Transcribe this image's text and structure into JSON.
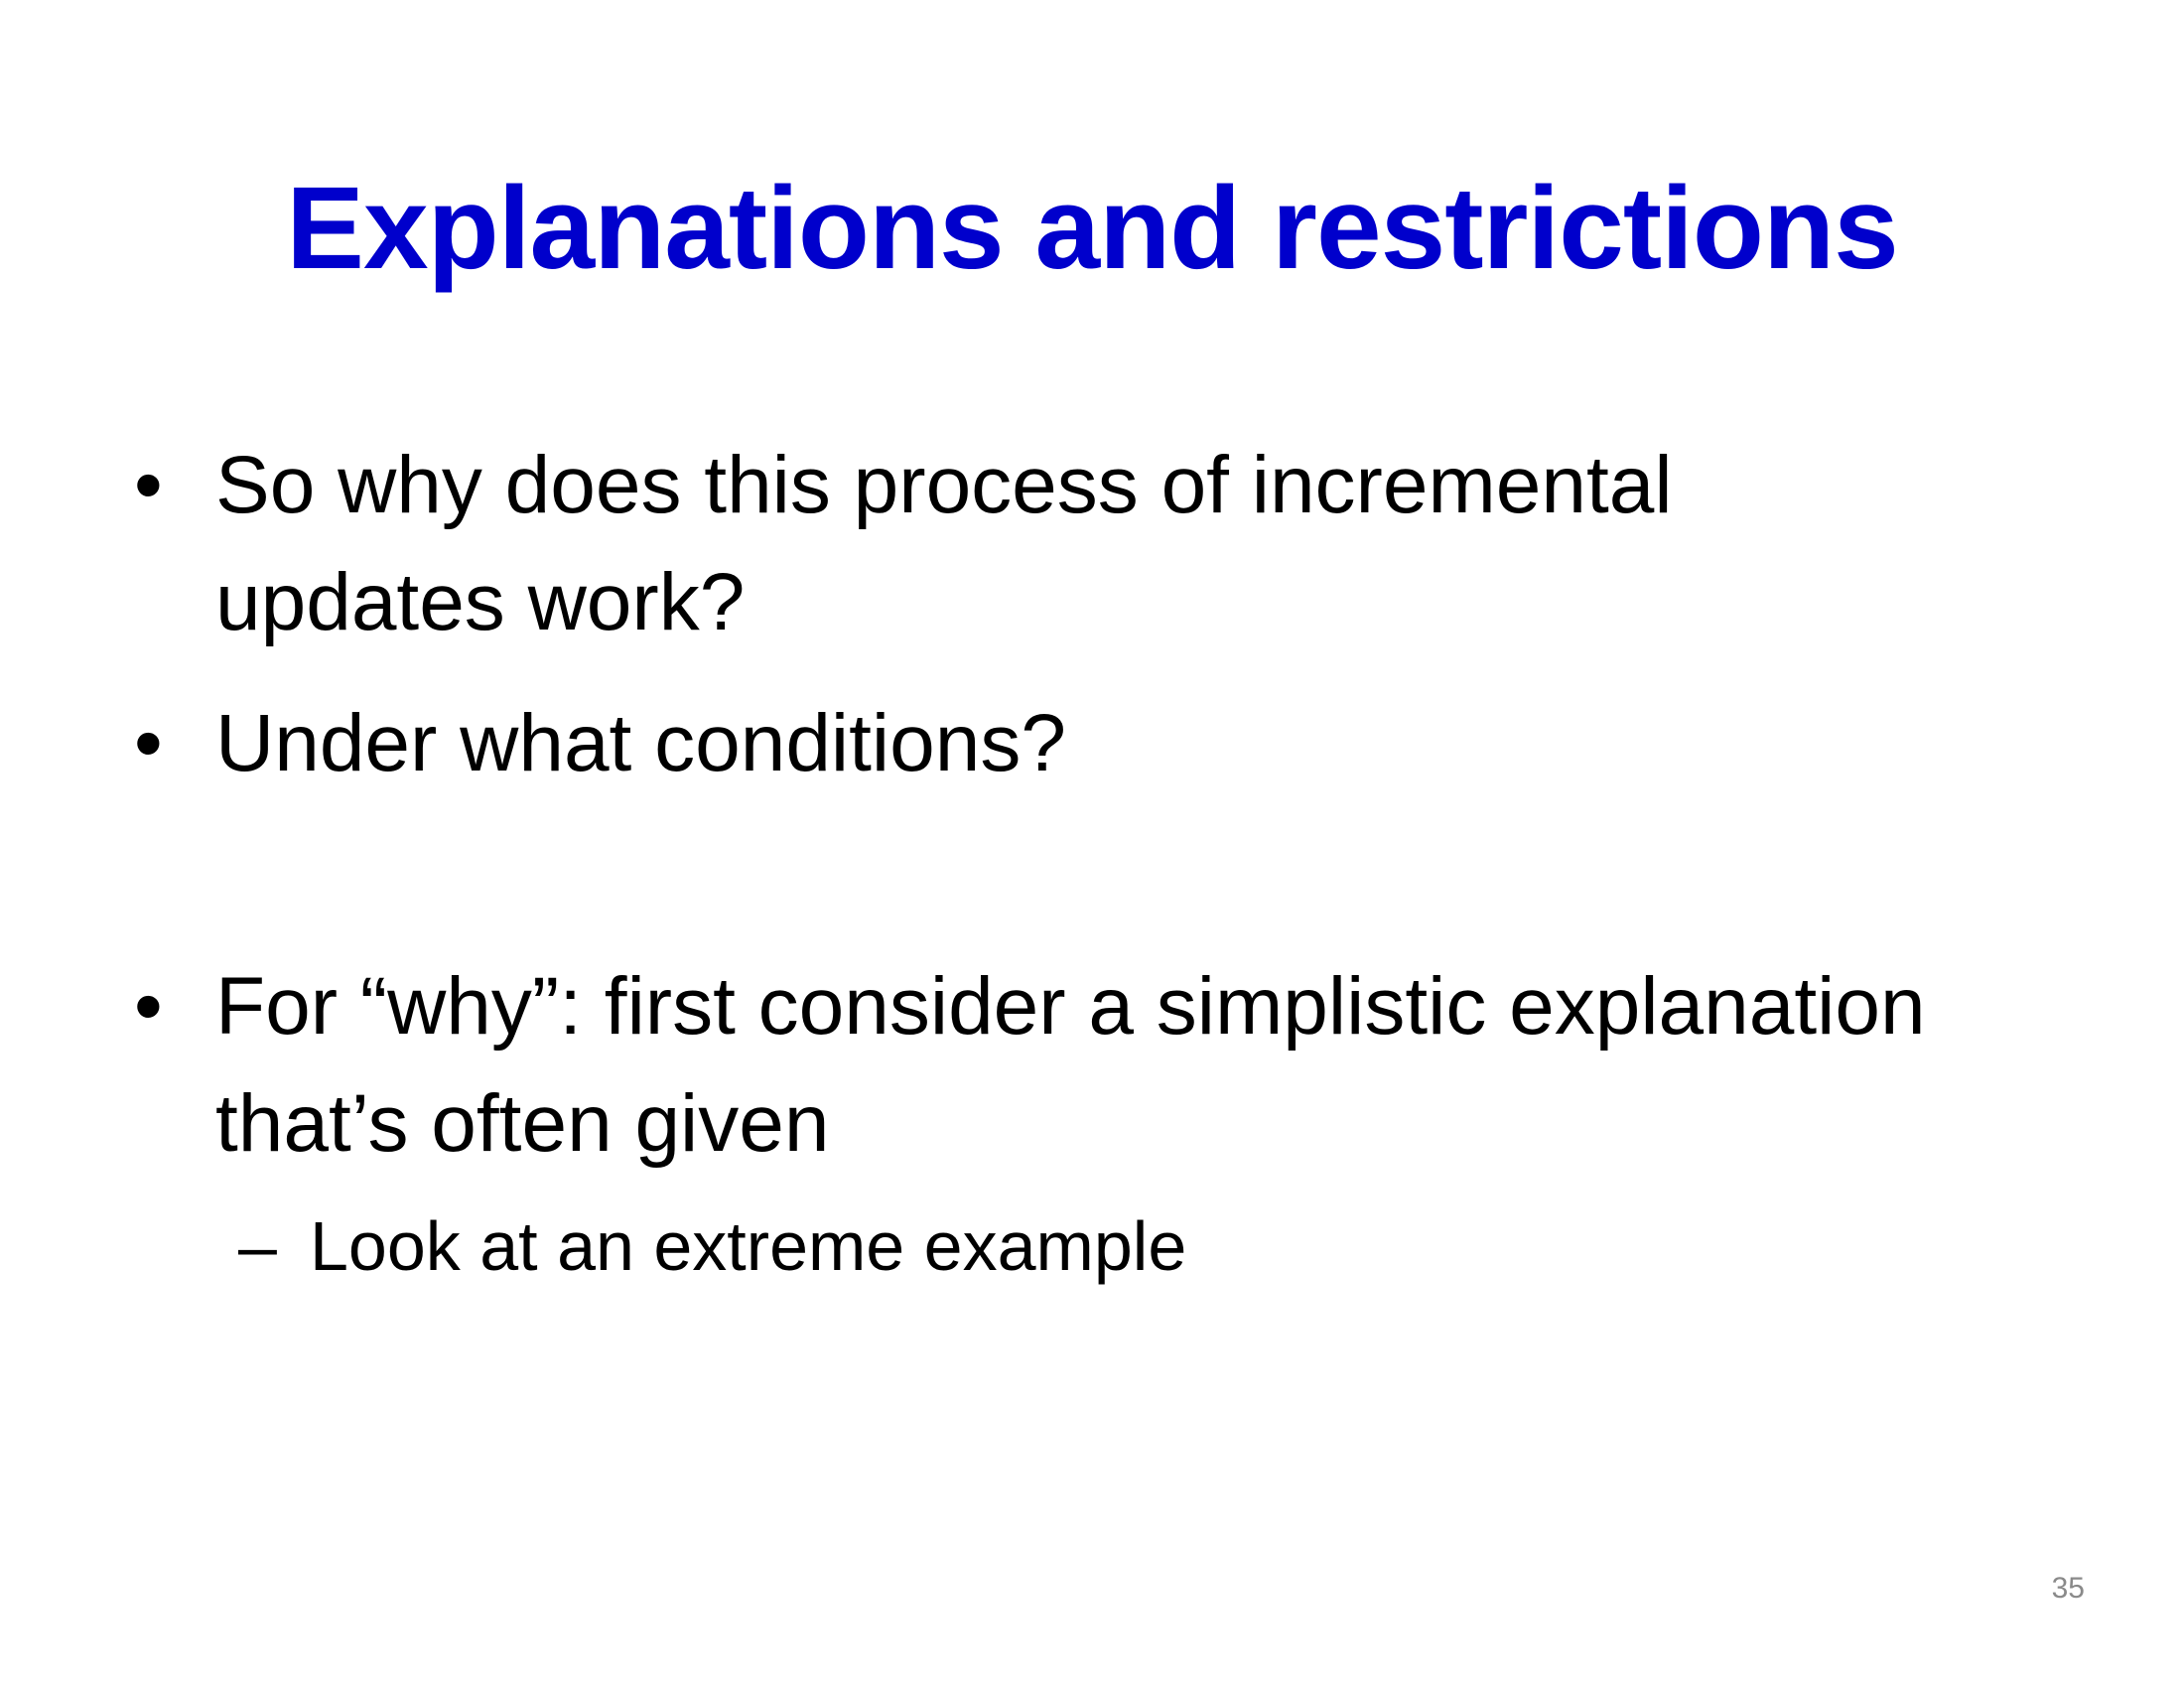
{
  "slide": {
    "title": "Explanations and restrictions",
    "bullet_symbol": "•",
    "bullets": [
      {
        "text": "So why does this process of incremental updates work?"
      },
      {
        "text": "Under what conditions?"
      },
      {
        "text": "For “why”: first consider a simplistic explanation that’s often given"
      }
    ],
    "sub_bullet_symbol": "–",
    "sub_bullets": [
      {
        "text": "Look at an extreme example"
      }
    ],
    "page_number": "35"
  },
  "colors": {
    "title": "#0000cc",
    "body_text": "#000000",
    "page_number": "#8a8a8a",
    "background": "#ffffff"
  }
}
